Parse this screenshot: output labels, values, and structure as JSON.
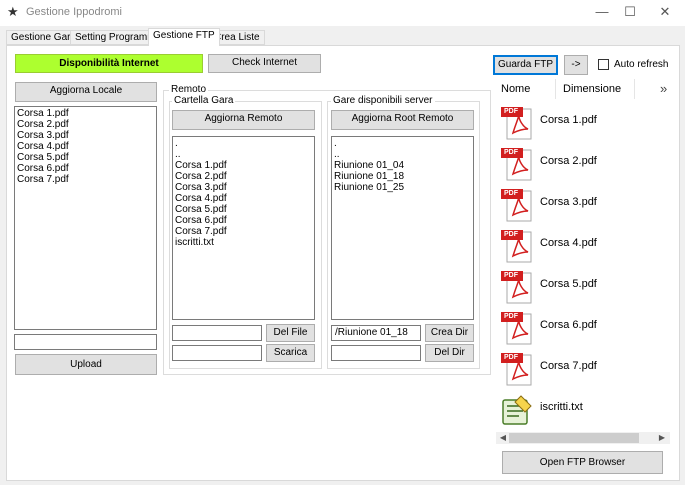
{
  "window": {
    "title": "Gestione Ippodromi",
    "controls": {
      "minimize": "—",
      "maximize": "☐",
      "close": "✕"
    }
  },
  "tabs": [
    "Gestione Gara",
    "Setting Programma",
    "Gestione FTP",
    "Crea Liste"
  ],
  "internet": {
    "status_label": "Disponibilità Internet",
    "status_color": "#adff2f",
    "check_button": "Check Internet"
  },
  "local": {
    "refresh_button": "Aggiorna Locale",
    "files": [
      "Corsa 1.pdf",
      "Corsa 2.pdf",
      "Corsa 3.pdf",
      "Corsa 4.pdf",
      "Corsa 5.pdf",
      "Corsa 6.pdf",
      "Corsa 7.pdf"
    ],
    "path_value": "",
    "upload_button": "Upload"
  },
  "remote": {
    "group_label": "Remoto",
    "cartella": {
      "label": "Cartella Gara",
      "refresh_button": "Aggiorna Remoto",
      "files": [
        ".",
        "..",
        "Corsa 1.pdf",
        "Corsa 2.pdf",
        "Corsa 3.pdf",
        "Corsa 4.pdf",
        "Corsa 5.pdf",
        "Corsa 6.pdf",
        "Corsa 7.pdf",
        "iscritti.txt"
      ],
      "del_value": "",
      "scarica_value": "",
      "del_button": "Del File",
      "scarica_button": "Scarica"
    },
    "server": {
      "label": "Gare disponibili server",
      "refresh_button": "Aggiorna Root Remoto",
      "folders": [
        ".",
        "..",
        "Riunione 01_04",
        "Riunione 01_18",
        "Riunione 01_25"
      ],
      "dir_value": "/Riunione 01_18",
      "del_dir_value": "",
      "crea_dir_button": "Crea Dir",
      "del_dir_button": "Del Dir"
    }
  },
  "ftp": {
    "guarda_button": "Guarda FTP",
    "arrow_button": "->",
    "auto_refresh_label": "Auto refresh",
    "columns": [
      "Nome",
      "Dimensione"
    ],
    "more_indicator": "»",
    "files": [
      {
        "name": "Corsa 1.pdf",
        "icon": "pdf-icon"
      },
      {
        "name": "Corsa 2.pdf",
        "icon": "pdf-icon"
      },
      {
        "name": "Corsa 3.pdf",
        "icon": "pdf-icon"
      },
      {
        "name": "Corsa 4.pdf",
        "icon": "pdf-icon"
      },
      {
        "name": "Corsa 5.pdf",
        "icon": "pdf-icon"
      },
      {
        "name": "Corsa 6.pdf",
        "icon": "pdf-icon"
      },
      {
        "name": "Corsa 7.pdf",
        "icon": "pdf-icon"
      },
      {
        "name": "iscritti.txt",
        "icon": "text-file-icon"
      }
    ],
    "pdf_badge": "PDF",
    "open_browser_button": "Open FTP Browser"
  }
}
